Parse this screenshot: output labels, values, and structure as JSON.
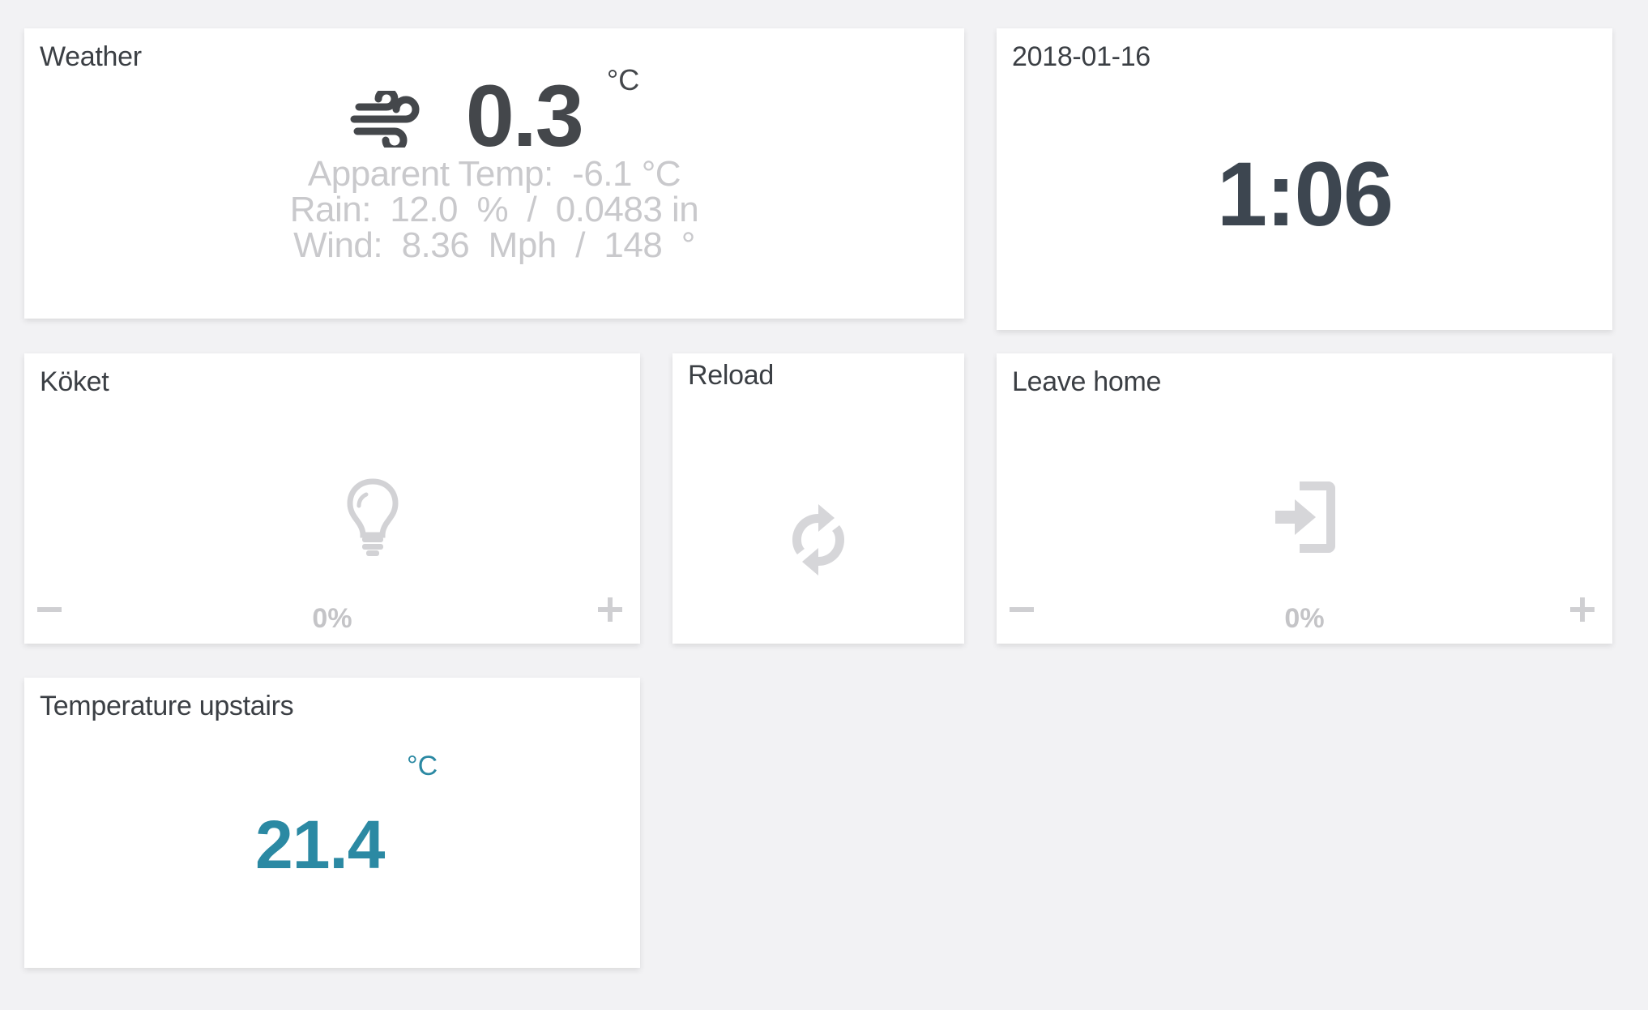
{
  "weather": {
    "title": "Weather",
    "icon": "wind-icon",
    "temperature": "0.3",
    "unit": "°C",
    "apparent_line": "Apparent Temp:  -6.1 °C",
    "rain_line": "Rain:  12.0  %  /  0.0483 in",
    "wind_line": "Wind:  8.36  Mph  /  148  °"
  },
  "clock": {
    "date": "2018-01-16",
    "time": "1:06"
  },
  "koket": {
    "title": "Köket",
    "icon": "lightbulb-icon",
    "level": "0%",
    "minus": "minus-icon",
    "plus": "plus-icon"
  },
  "reload": {
    "title": "Reload",
    "icon": "refresh-icon"
  },
  "leave_home": {
    "title": "Leave home",
    "icon": "sign-in-icon",
    "level": "0%"
  },
  "temperature_upstairs": {
    "title": "Temperature upstairs",
    "unit": "°C",
    "value": "21.4"
  },
  "colors": {
    "background": "#f2f2f4",
    "tile": "#ffffff",
    "sensor_accent": "#2b89a3",
    "clock_text": "#3d4650",
    "muted": "#c9c9cc"
  }
}
